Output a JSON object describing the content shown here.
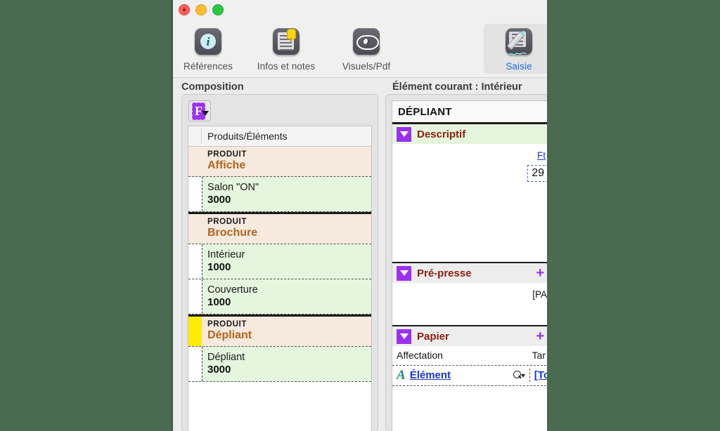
{
  "window": {
    "traffic_lights": [
      "close",
      "minimize",
      "zoom"
    ]
  },
  "toolbar": {
    "items": [
      {
        "label": "Références",
        "icon": "info-icon",
        "selected": false
      },
      {
        "label": "Infos et notes",
        "icon": "notes-icon",
        "selected": false
      },
      {
        "label": "Visuels/Pdf",
        "icon": "eye-icon",
        "selected": false
      },
      {
        "label": "Saisie",
        "icon": "edit-doc-icon",
        "selected": true
      }
    ]
  },
  "left_pane": {
    "title": "Composition",
    "format_button": {
      "glyph": "F",
      "name": "format-dropdown"
    },
    "list": {
      "column_header": "Produits/Éléments",
      "rows": [
        {
          "type": "product",
          "kind": "PRODUIT",
          "name": "Affiche",
          "flag": false,
          "top_rule": false
        },
        {
          "type": "element",
          "name": "Salon \"ON\"",
          "qty": "3000"
        },
        {
          "type": "product",
          "kind": "PRODUIT",
          "name": "Brochure",
          "flag": false,
          "top_rule": true
        },
        {
          "type": "element",
          "name": "Intérieur",
          "qty": "1000"
        },
        {
          "type": "element",
          "name": "Couverture",
          "qty": "1000"
        },
        {
          "type": "product",
          "kind": "PRODUIT",
          "name": "Dépliant",
          "flag": true,
          "top_rule": true
        },
        {
          "type": "element",
          "name": "Dépliant",
          "qty": "3000"
        }
      ]
    }
  },
  "right_pane": {
    "title": "Élément courant : Intérieur",
    "form_title": "DÉPLIANT",
    "sections": [
      {
        "name": "Descriptif",
        "style": "green",
        "has_plus": false,
        "link_label": "Ft",
        "field_value": "29"
      },
      {
        "name": "Pré-presse",
        "style": "grey",
        "has_plus": true,
        "plus_label": "+",
        "body_text": "[PA"
      },
      {
        "name": "Papier",
        "style": "grey",
        "has_plus": true,
        "plus_label": "+",
        "table": {
          "headers": [
            "Affectation",
            "Tar"
          ],
          "rows": [
            {
              "icon": "text-style-icon",
              "label": "Élément",
              "search_icon": "magnifier-icon",
              "value": "[To"
            }
          ]
        }
      }
    ]
  },
  "colors": {
    "desktop": "#4a6b50",
    "accent_purple": "#9b30ef",
    "section_title_red": "#8b2010",
    "product_name_orange": "#b5651d",
    "element_row_green": "#e4f6dd",
    "product_row_beige": "#f6e9de",
    "flag_yellow": "#ffec00",
    "selected_tab_blue": "#1a6ae0",
    "link_blue": "#1a34c8"
  }
}
